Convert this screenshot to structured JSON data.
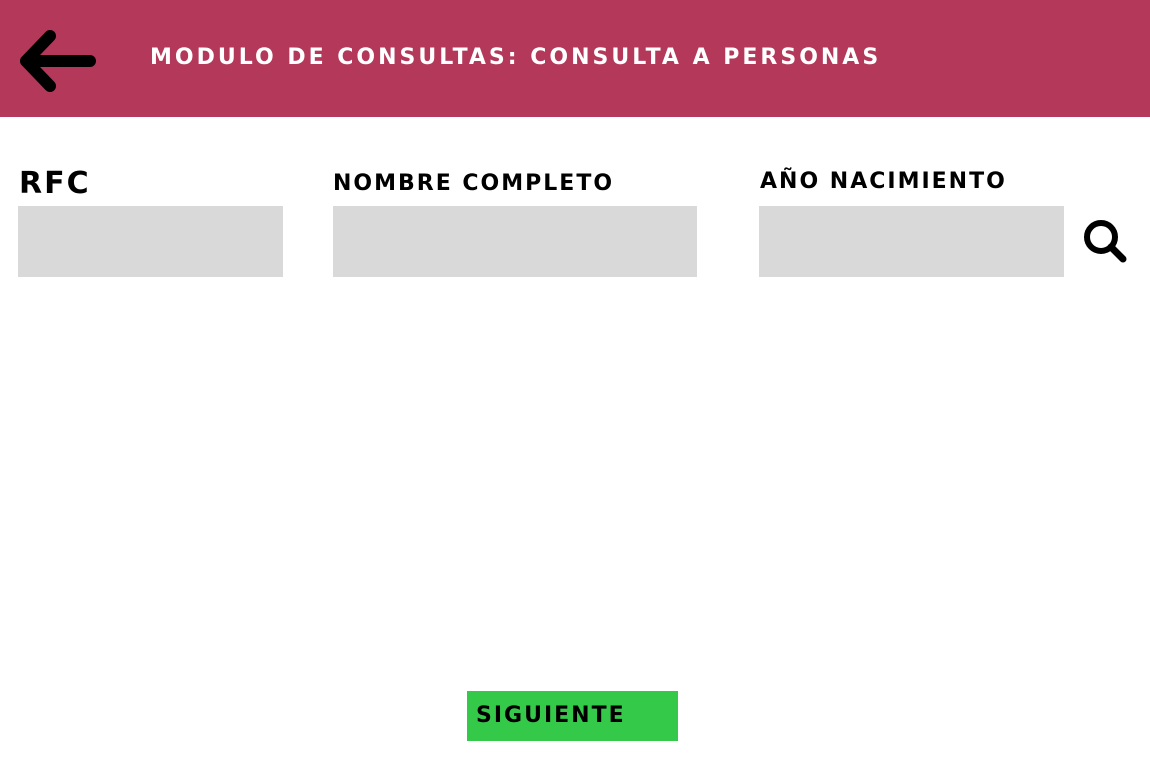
{
  "header": {
    "title": "MODULO DE CONSULTAS:  CONSULTA A PERSONAS",
    "back_icon": "arrow-left-icon",
    "background_color": "#b3385a"
  },
  "form": {
    "rfc_label": "RFC",
    "rfc_value": "",
    "nombre_label": "NOMBRE COMPLETO",
    "nombre_value": "",
    "anio_label": "AÑO NACIMIENTO",
    "anio_value": "",
    "search_icon": "search-icon",
    "input_color": "#d9d9d9"
  },
  "footer": {
    "next_label": "SIGUIENTE",
    "next_color": "#35c94a"
  }
}
